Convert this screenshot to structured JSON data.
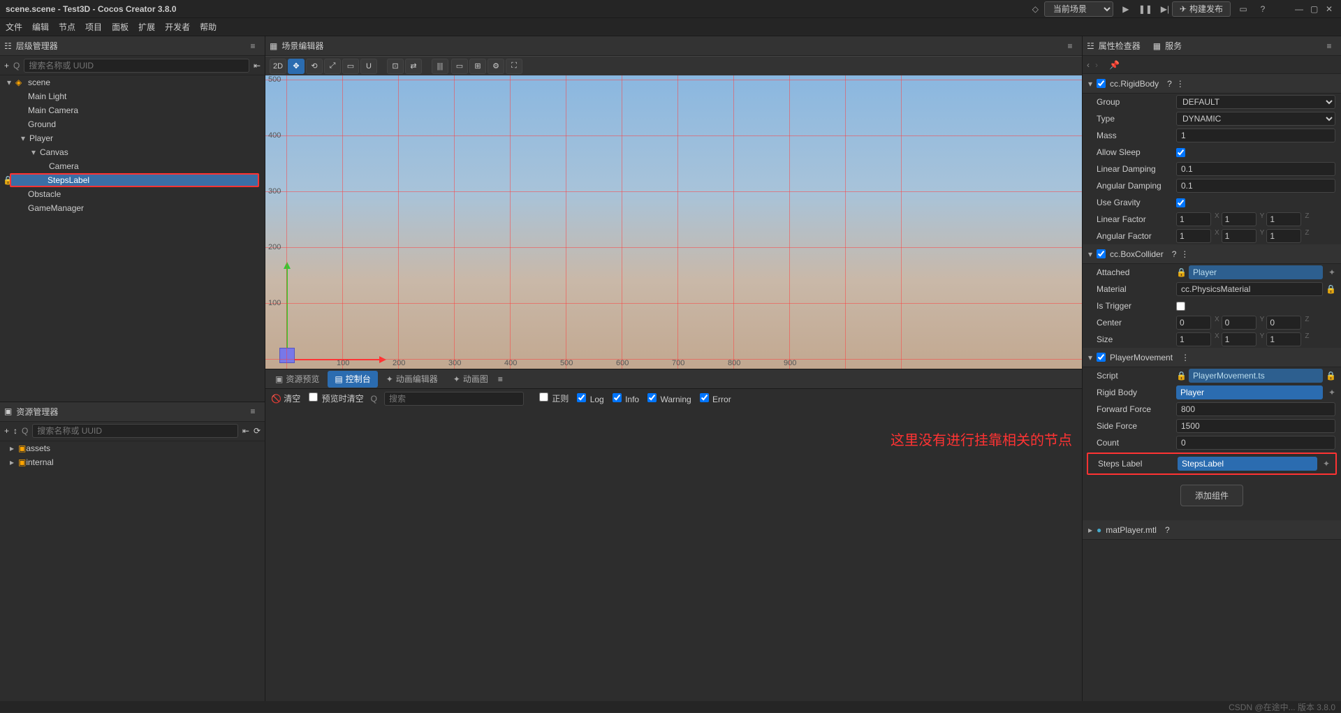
{
  "window_title": "scene.scene - Test3D - Cocos Creator 3.8.0",
  "menu": [
    "文件",
    "编辑",
    "节点",
    "项目",
    "面板",
    "扩展",
    "开发者",
    "帮助"
  ],
  "top_center": {
    "scene_selector": "当前场景"
  },
  "top_right": {
    "build_publish": "构建发布"
  },
  "panels": {
    "hierarchy": "层级管理器",
    "scene": "场景编辑器",
    "assets": "资源管理器",
    "inspector": "属性检查器",
    "services": "服务"
  },
  "hierarchy": {
    "search_placeholder": "搜索名称或 UUID",
    "nodes": {
      "scene": "scene",
      "main_light": "Main Light",
      "main_camera": "Main Camera",
      "ground": "Ground",
      "player": "Player",
      "canvas": "Canvas",
      "camera": "Camera",
      "steps_label": "StepsLabel",
      "obstacle": "Obstacle",
      "game_manager": "GameManager"
    }
  },
  "assets": {
    "search_placeholder": "搜索名称或 UUID",
    "items": [
      "assets",
      "internal"
    ]
  },
  "scene_toolbar_2d": "2D",
  "bottom_tabs": [
    "资源预览",
    "控制台",
    "动画编辑器",
    "动画图"
  ],
  "console_bar": {
    "clear": "清空",
    "clear_on_preview": "预览时清空",
    "search_placeholder": "搜索",
    "regex": "正则",
    "log": "Log",
    "info": "Info",
    "warning": "Warning",
    "error": "Error"
  },
  "annotation_text": "这里没有进行挂靠相关的节点",
  "inspector": {
    "rigidbody": {
      "title": "cc.RigidBody",
      "group": "Group",
      "group_val": "DEFAULT",
      "type": "Type",
      "type_val": "DYNAMIC",
      "mass": "Mass",
      "mass_val": "1",
      "allow_sleep": "Allow Sleep",
      "linear_damping": "Linear Damping",
      "linear_damping_val": "0.1",
      "angular_damping": "Angular Damping",
      "angular_damping_val": "0.1",
      "use_gravity": "Use Gravity",
      "linear_factor": "Linear Factor",
      "angular_factor": "Angular Factor",
      "vx": "1",
      "vy": "1",
      "vz": "1"
    },
    "boxcollider": {
      "title": "cc.BoxCollider",
      "attached": "Attached",
      "attached_val": "Player",
      "material": "Material",
      "material_val": "cc.PhysicsMaterial",
      "is_trigger": "Is Trigger",
      "center": "Center",
      "cx": "0",
      "cy": "0",
      "cz": "0",
      "size": "Size",
      "sx": "1",
      "sy": "1",
      "sz": "1"
    },
    "player_movement": {
      "title": "PlayerMovement",
      "script": "Script",
      "script_val": "PlayerMovement.ts",
      "rigid_body": "Rigid Body",
      "rigid_body_val": "Player",
      "forward_force": "Forward Force",
      "forward_force_val": "800",
      "side_force": "Side Force",
      "side_force_val": "1500",
      "count": "Count",
      "count_val": "0",
      "steps_label": "Steps Label",
      "steps_label_val": "StepsLabel"
    },
    "add_component": "添加组件",
    "mat_player": "matPlayer.mtl"
  },
  "status": "CSDN @在途中... 版本 3.8.0",
  "axis_labels": [
    "100",
    "200",
    "300",
    "400",
    "500",
    "600",
    "700",
    "800",
    "900"
  ]
}
